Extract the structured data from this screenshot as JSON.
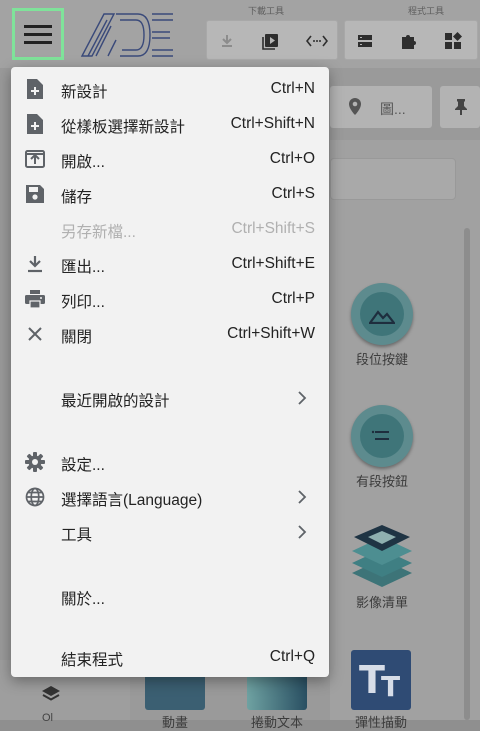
{
  "toolbar": {
    "download_group_label": "下載工具",
    "program_group_label": "程式工具",
    "search_hint": "圖..."
  },
  "palette": {
    "items": [
      {
        "label": "段位按鍵"
      },
      {
        "label": "有段按鈕"
      },
      {
        "label": "影像清單"
      }
    ],
    "bottom_labels": [
      "動畫",
      "捲動文本",
      "彈性描動"
    ],
    "left_bottom_label": "Ol"
  },
  "file_menu": {
    "items": [
      {
        "label": "新設計",
        "shortcut": "Ctrl+N",
        "icon": "new-file-icon"
      },
      {
        "label": "從樣板選擇新設計",
        "shortcut": "Ctrl+Shift+N",
        "icon": "new-from-template-icon"
      },
      {
        "label": "開啟...",
        "shortcut": "Ctrl+O",
        "icon": "open-icon"
      },
      {
        "label": "儲存",
        "shortcut": "Ctrl+S",
        "icon": "save-icon"
      },
      {
        "label": "另存新檔...",
        "shortcut": "Ctrl+Shift+S",
        "icon": "",
        "disabled": true
      },
      {
        "label": "匯出...",
        "shortcut": "Ctrl+Shift+E",
        "icon": "export-icon"
      },
      {
        "label": "列印...",
        "shortcut": "Ctrl+P",
        "icon": "print-icon"
      },
      {
        "label": "關閉",
        "shortcut": "Ctrl+Shift+W",
        "icon": "close-icon"
      },
      {
        "label": "最近開啟的設計",
        "submenu": true
      },
      {
        "label": "設定...",
        "icon": "gear-icon"
      },
      {
        "label": "選擇語言(Language)",
        "icon": "globe-icon",
        "submenu": true
      },
      {
        "label": "工具",
        "submenu": true
      },
      {
        "label": "關於..."
      },
      {
        "label": "結束程式",
        "shortcut": "Ctrl+Q"
      }
    ]
  }
}
